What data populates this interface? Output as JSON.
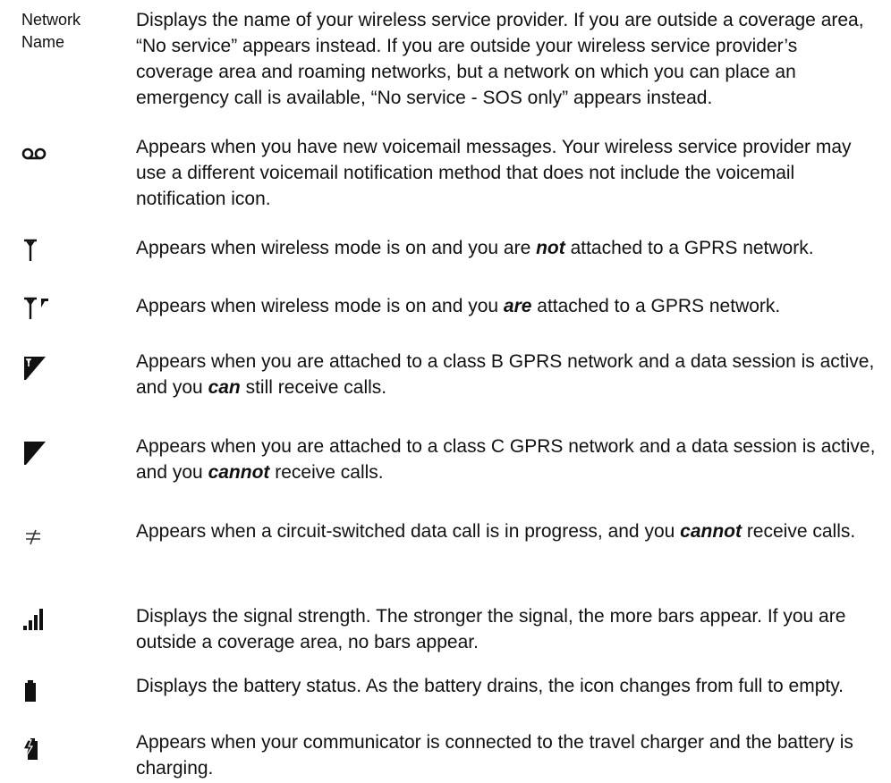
{
  "rows": [
    {
      "label": "Network Name",
      "parts": [
        {
          "t": "Displays the name of your wireless service provider. If you are outside a coverage area, “No service” appears instead. If you are outside your wireless service provider’s coverage area and roaming networks, but a network on which you can place an emergency call is available, “No service - SOS only” appears instead."
        }
      ]
    },
    {
      "icon": "voicemail-icon",
      "parts": [
        {
          "t": "Appears when you have new voicemail messages. Your wireless service provider may use a different voicemail notification method that does not include the voicemail notification icon."
        }
      ]
    },
    {
      "icon": "antenna-icon",
      "parts": [
        {
          "t": "Appears when wireless mode is on and you are "
        },
        {
          "t": "not",
          "em": true
        },
        {
          "t": " attached to a GPRS network."
        }
      ]
    },
    {
      "icon": "gprs-attached-icon",
      "parts": [
        {
          "t": "Appears when wireless mode is on and you "
        },
        {
          "t": "are",
          "em": true
        },
        {
          "t": " attached to a GPRS network."
        }
      ]
    },
    {
      "icon": "gprs-class-b-icon",
      "parts": [
        {
          "t": "Appears when you are attached to a class B GPRS network and a data session is active, and you "
        },
        {
          "t": "can",
          "em": true
        },
        {
          "t": " still receive calls."
        }
      ]
    },
    {
      "icon": "gprs-class-c-icon",
      "parts": [
        {
          "t": "Appears when you are attached to a class C GPRS network and a data session is active, and you "
        },
        {
          "t": "cannot",
          "em": true
        },
        {
          "t": " receive calls."
        }
      ]
    },
    {
      "icon": "circuit-switched-data-icon",
      "parts": [
        {
          "t": "Appears when a circuit-switched data call is in progress, and you "
        },
        {
          "t": "cannot",
          "em": true
        },
        {
          "t": " receive calls."
        }
      ]
    },
    {
      "icon": "signal-strength-icon",
      "parts": [
        {
          "t": "Displays the signal strength. The stronger the signal, the more bars appear. If you are outside a coverage area, no bars appear."
        }
      ]
    },
    {
      "icon": "battery-icon",
      "parts": [
        {
          "t": "Displays the battery status. As the battery drains, the icon changes from full to empty."
        }
      ]
    },
    {
      "icon": "battery-charging-icon",
      "parts": [
        {
          "t": "Appears when your communicator is connected to the travel charger and the battery is charging."
        }
      ]
    }
  ]
}
